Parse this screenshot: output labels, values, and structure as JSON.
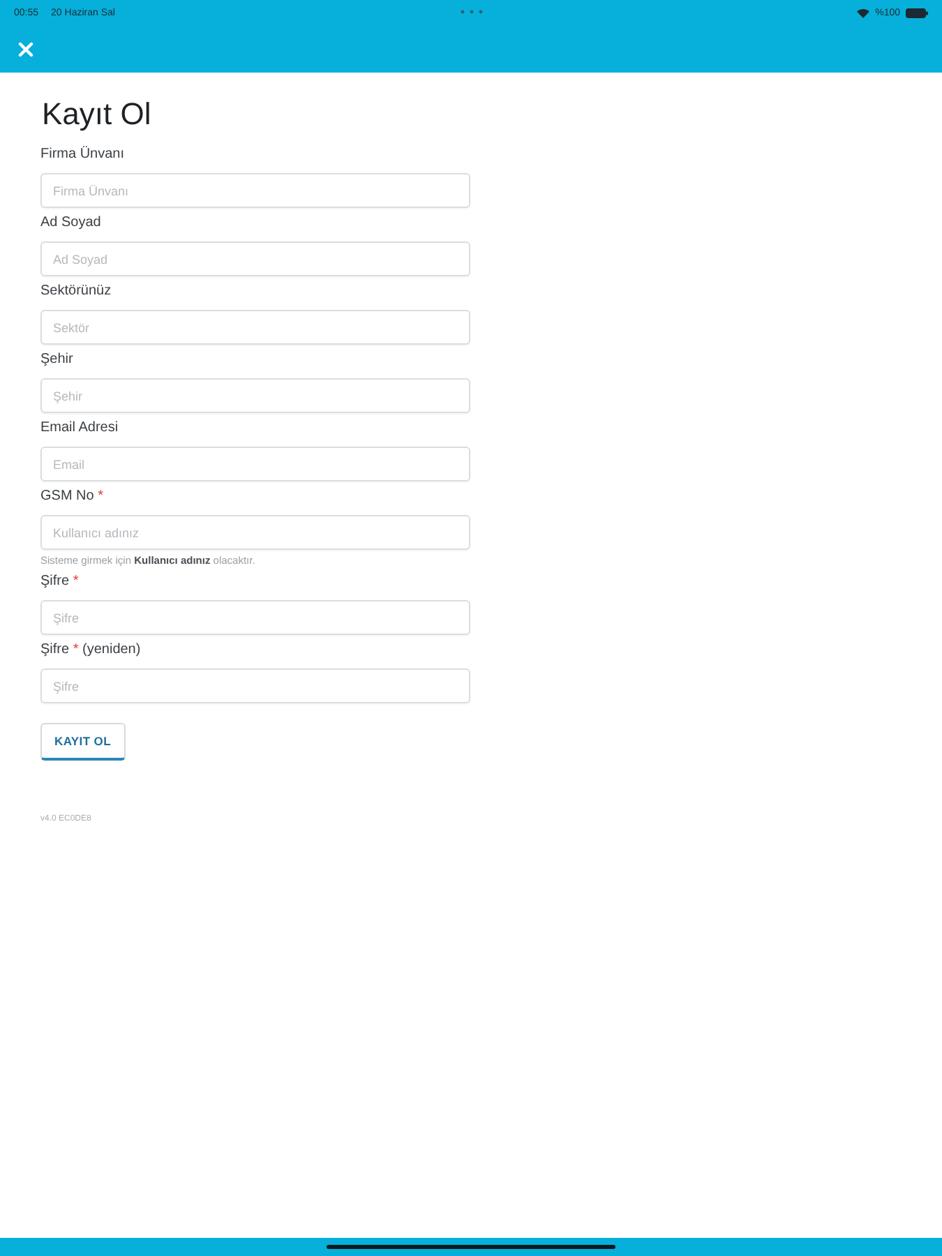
{
  "status_bar": {
    "time": "00:55",
    "date": "20 Haziran Sal",
    "battery": "%100"
  },
  "title": "Kayıt Ol",
  "fields": [
    {
      "label": "Firma Ünvanı",
      "placeholder": "Firma Ünvanı"
    },
    {
      "label": "Ad Soyad",
      "placeholder": "Ad Soyad"
    },
    {
      "label": "Sektörünüz",
      "placeholder": "Sektör"
    },
    {
      "label": "Şehir",
      "placeholder": "Şehir"
    },
    {
      "label": "Email Adresi",
      "placeholder": "Email"
    },
    {
      "label": "GSM No",
      "required_mark": "*",
      "placeholder": "Kullanıcı adınız",
      "help": "Sisteme girmek için **Kullanıcı adınız** olacaktır."
    },
    {
      "label": "Şifre",
      "required_mark": "*",
      "placeholder": "Şifre"
    },
    {
      "label": "Şifre",
      "required_mark": "*",
      "label_suffix": "(yeniden)",
      "placeholder": "Şifre"
    }
  ],
  "submit_button": "KAYIT OL",
  "version": "v4.0 EC0DE8"
}
